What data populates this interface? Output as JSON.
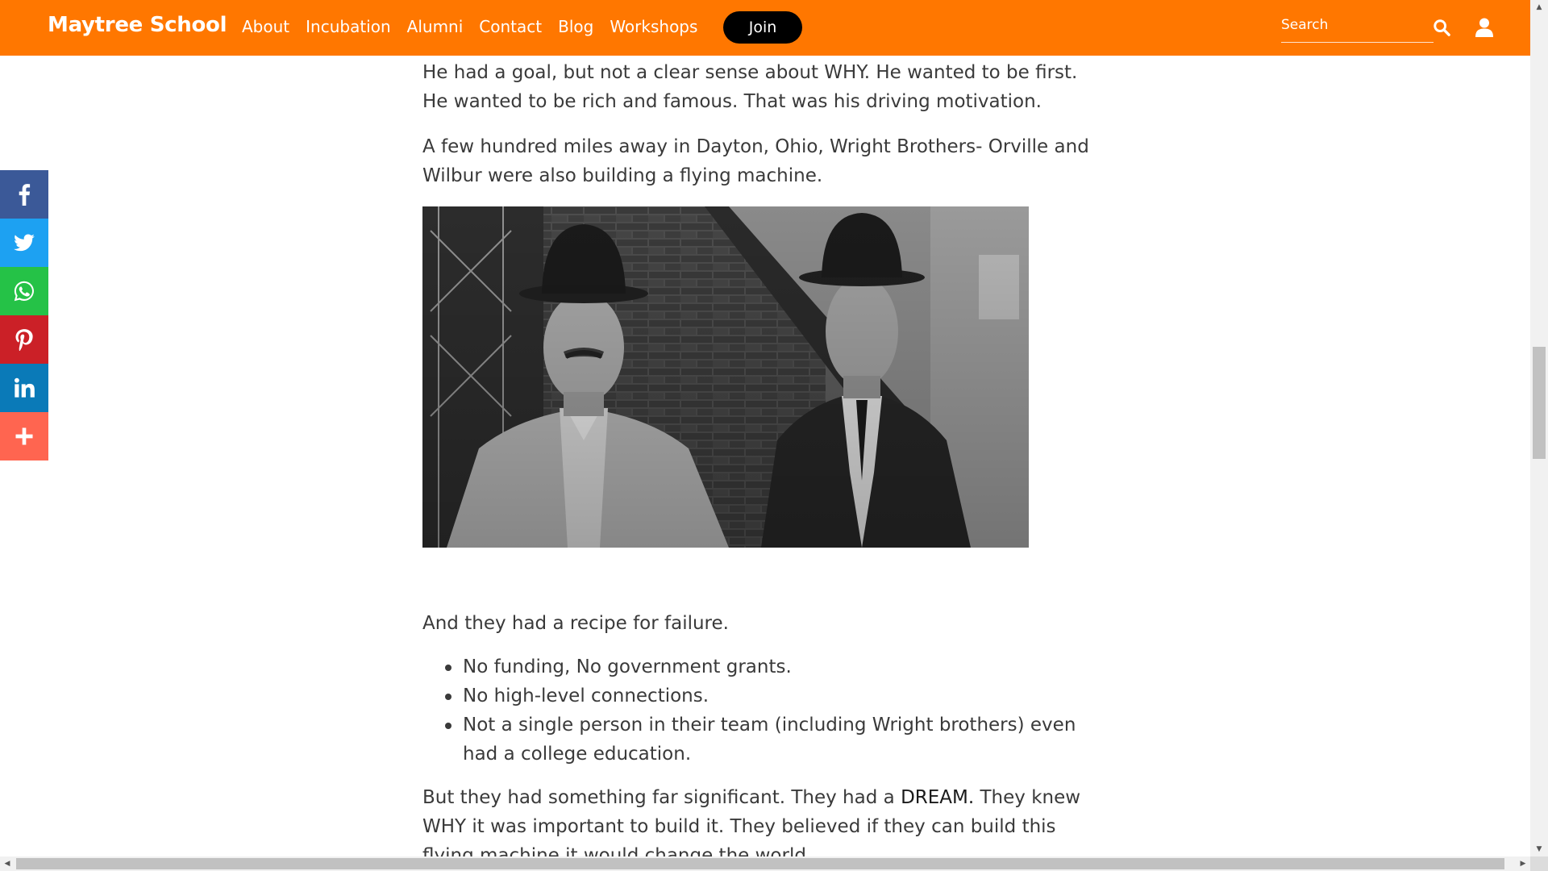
{
  "header": {
    "logo": "Maytree School",
    "nav": [
      "About",
      "Incubation",
      "Alumni",
      "Contact",
      "Blog",
      "Workshops"
    ],
    "join_label": "Join",
    "search_placeholder": "Search",
    "colors": {
      "bar": "#ff7700",
      "join_bg": "#000000",
      "text": "#ffffff"
    }
  },
  "share": [
    {
      "icon": "facebook-icon",
      "color": "#3b5998"
    },
    {
      "icon": "twitter-icon",
      "color": "#1da1f2"
    },
    {
      "icon": "whatsapp-icon",
      "color": "#25c247"
    },
    {
      "icon": "pinterest-icon",
      "color": "#cb2027"
    },
    {
      "icon": "linkedin-icon",
      "color": "#0a7ab8"
    },
    {
      "icon": "plus-icon",
      "color": "#ff6550"
    }
  ],
  "article": {
    "p1": "He had a goal, but not a clear sense about WHY. He wanted to be first. He wanted to be rich and famous. That was his driving motivation.",
    "p2": "A few hundred miles away in Dayton, Ohio, Wright Brothers- Orville and Wilbur were also building a flying machine.",
    "p3": "And they had a recipe for failure.",
    "bullets": [
      "No funding, No government grants.",
      "No high-level connections.",
      "Not a single person in their team (including Wright brothers) even had a college education."
    ],
    "p4_a": "But they had something far significant. They had a ",
    "p4_strong": "DREAM.",
    "p4_b": " They knew WHY it was important to build it. They believed if they can build this flying machine it would change the world."
  }
}
